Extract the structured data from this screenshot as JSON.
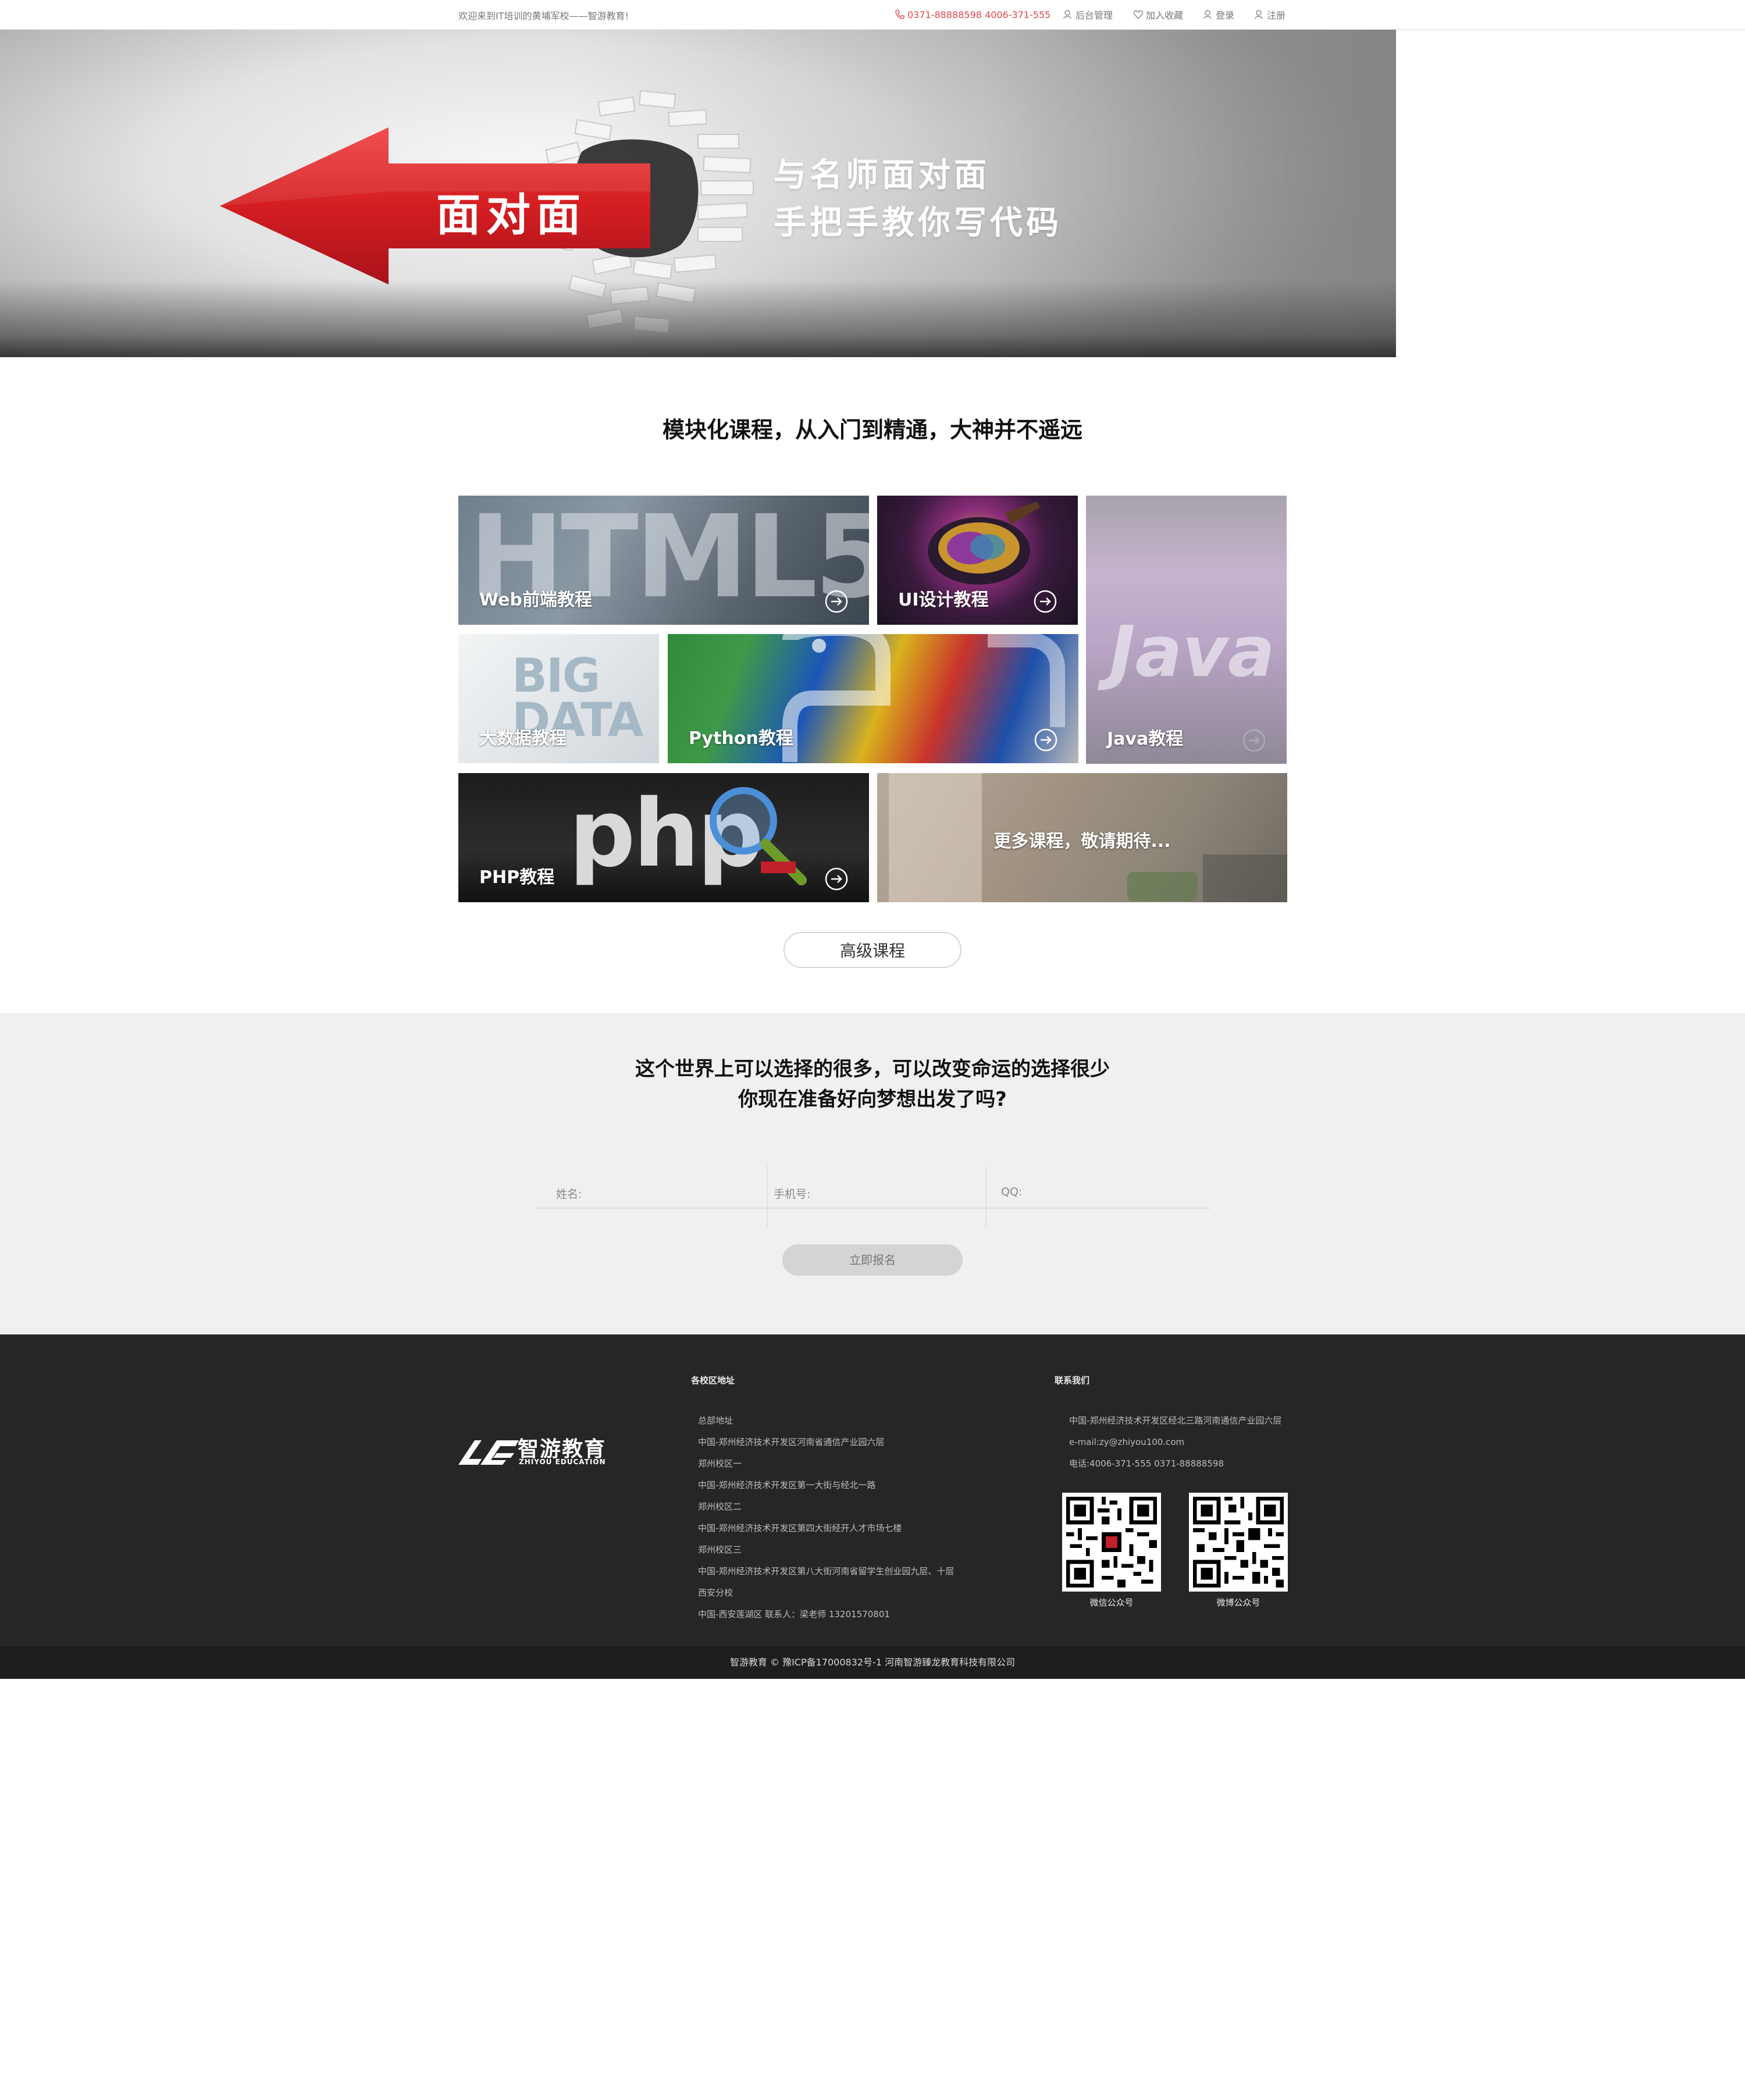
{
  "topbar": {
    "welcome": "欢迎来到IT培训的黄埔军校——智游教育!",
    "phone": "0371-88888598 4006-371-555",
    "links": [
      "后台管理",
      "加入收藏",
      "登录",
      "注册"
    ]
  },
  "banner": {
    "arrow_text": "面对面",
    "slogan_line1": "与名师面对面",
    "slogan_line2": "手把手教你写代码"
  },
  "courses": {
    "title": "模块化课程，从入门到精通，大神并不遥远",
    "tiles": [
      {
        "label": "Web前端教程",
        "image_text": "HTML5"
      },
      {
        "label": "UI设计教程"
      },
      {
        "label": "Java教程",
        "image_text": "Java"
      },
      {
        "label": "大数据教程",
        "image_text": "BIG DATA"
      },
      {
        "label": "Python教程"
      },
      {
        "label": "PHP教程",
        "image_text": "php"
      },
      {
        "label": "更多课程，敬请期待..."
      }
    ],
    "advanced_button": "高级课程"
  },
  "enroll": {
    "line1": "这个世界上可以选择的很多，可以改变命运的选择很少",
    "line2": "你现在准备好向梦想出发了吗?",
    "fields": [
      "姓名:",
      "手机号:",
      "QQ:"
    ],
    "submit": "立即报名"
  },
  "footer": {
    "logo_cn": "智游教育",
    "logo_en": "ZHIYOU EDUCATION",
    "campus_heading": "各校区地址",
    "campus_lines": [
      "总部地址",
      "中国-郑州经济技术开发区河南省通信产业园六层",
      "郑州校区一",
      "中国-郑州经济技术开发区第一大街与经北一路",
      "郑州校区二",
      "中国-郑州经济技术开发区第四大街经开人才市场七楼",
      "郑州校区三",
      "中国-郑州经济技术开发区第八大街河南省留学生创业园九层、十层",
      "西安分校",
      "中国-西安莲湖区 联系人：梁老师 13201570801"
    ],
    "contact_heading": "联系我们",
    "contact_lines": [
      "中国-郑州经济技术开发区经北三路河南通信产业园六层",
      "e-mail:zy@zhiyou100.com",
      "电话:4006-371-555 0371-88888598"
    ],
    "qr_captions": [
      "微信公众号",
      "微博公众号"
    ],
    "copyright": "智游教育 © 豫ICP备17000832号-1 河南智游臻龙教育科技有限公司"
  },
  "colors": {
    "accent_red": "#e2484a",
    "footer_bg": "#262626",
    "enroll_bg": "#f0f0f0"
  }
}
